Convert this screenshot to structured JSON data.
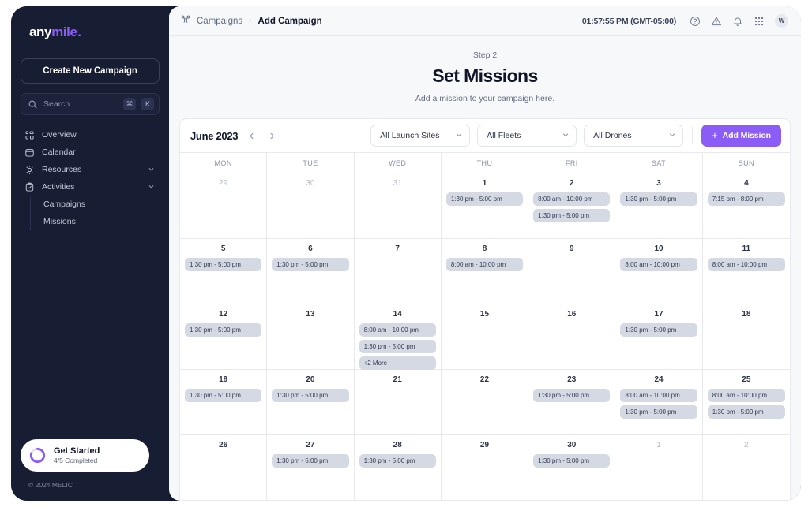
{
  "sidebar": {
    "logo": {
      "part1": "any",
      "part2": "mile",
      "dot": "."
    },
    "create_button": "Create New Campaign",
    "search": {
      "placeholder": "Search",
      "kbd1": "⌘",
      "kbd2": "K",
      "icon": "search-icon"
    },
    "items": [
      {
        "label": "Overview",
        "icon": "overview-grid-icon",
        "expandable": false
      },
      {
        "label": "Calendar",
        "icon": "calendar-icon",
        "expandable": false
      },
      {
        "label": "Resources",
        "icon": "sun-resources-icon",
        "expandable": true
      },
      {
        "label": "Activities",
        "icon": "clipboard-check-icon",
        "expandable": true
      }
    ],
    "sub_items": [
      {
        "label": "Campaigns"
      },
      {
        "label": "Missions"
      }
    ],
    "get_started": {
      "title": "Get Started",
      "subtitle": "4/5 Completed",
      "progress": 80
    },
    "copyright": "© 2024 MELIC"
  },
  "topbar": {
    "breadcrumb": {
      "icon": "drone-icon",
      "parent": "Campaigns",
      "separator": "›",
      "current": "Add Campaign"
    },
    "clock": "01:57:55 PM (GMT-05:00)",
    "icons": [
      "help-circle-icon",
      "warning-triangle-icon",
      "bell-icon",
      "apps-grid-icon"
    ],
    "avatar_initial": "W"
  },
  "step": {
    "kicker": "Step 2",
    "title": "Set Missions",
    "subtitle": "Add a mission to your campaign here."
  },
  "calendar": {
    "month_label": "June 2023",
    "prev_label": "‹",
    "next_label": "›",
    "filters": [
      {
        "name": "launch-sites",
        "value": "All Launch Sites"
      },
      {
        "name": "fleets",
        "value": "All Fleets"
      },
      {
        "name": "drones",
        "value": "All Drones"
      }
    ],
    "add_mission_label": "Add Mission",
    "accent_color": "#8b5cf6",
    "pill_color": "#d5d9e3",
    "day_headers": [
      "MON",
      "TUE",
      "WED",
      "THU",
      "FRI",
      "SAT",
      "SUN"
    ],
    "weeks": [
      [
        {
          "day": "29",
          "muted": true,
          "events": []
        },
        {
          "day": "30",
          "muted": true,
          "events": []
        },
        {
          "day": "31",
          "muted": true,
          "events": []
        },
        {
          "day": "1",
          "muted": false,
          "events": [
            "1:30 pm - 5:00 pm"
          ]
        },
        {
          "day": "2",
          "muted": false,
          "events": [
            "8:00 am - 10:00 pm",
            "1:30 pm - 5:00 pm"
          ]
        },
        {
          "day": "3",
          "muted": false,
          "events": [
            "1:30 pm - 5:00 pm"
          ]
        },
        {
          "day": "4",
          "muted": false,
          "events": [
            "7:15 pm - 8:00 pm"
          ]
        }
      ],
      [
        {
          "day": "5",
          "muted": false,
          "events": [
            "1:30 pm - 5:00 pm"
          ]
        },
        {
          "day": "6",
          "muted": false,
          "events": [
            "1:30 pm - 5:00 pm"
          ]
        },
        {
          "day": "7",
          "muted": false,
          "events": []
        },
        {
          "day": "8",
          "muted": false,
          "events": [
            "8:00 am - 10:00 pm"
          ]
        },
        {
          "day": "9",
          "muted": false,
          "events": []
        },
        {
          "day": "10",
          "muted": false,
          "events": [
            "8:00 am - 10:00 pm"
          ]
        },
        {
          "day": "11",
          "muted": false,
          "events": [
            "8:00 am - 10:00 pm"
          ]
        }
      ],
      [
        {
          "day": "12",
          "muted": false,
          "events": [
            "1:30 pm - 5:00 pm"
          ]
        },
        {
          "day": "13",
          "muted": false,
          "events": []
        },
        {
          "day": "14",
          "muted": false,
          "events": [
            "8:00 am - 10:00 pm",
            "1:30 pm - 5:00 pm",
            "+2 More"
          ]
        },
        {
          "day": "15",
          "muted": false,
          "events": []
        },
        {
          "day": "16",
          "muted": false,
          "events": []
        },
        {
          "day": "17",
          "muted": false,
          "events": [
            "1:30 pm - 5:00 pm"
          ]
        },
        {
          "day": "18",
          "muted": false,
          "events": []
        }
      ],
      [
        {
          "day": "19",
          "muted": false,
          "events": [
            "1:30 pm - 5:00 pm"
          ]
        },
        {
          "day": "20",
          "muted": false,
          "events": [
            "1:30 pm - 5:00 pm"
          ]
        },
        {
          "day": "21",
          "muted": false,
          "events": []
        },
        {
          "day": "22",
          "muted": false,
          "events": []
        },
        {
          "day": "23",
          "muted": false,
          "events": [
            "1:30 pm - 5:00 pm"
          ]
        },
        {
          "day": "24",
          "muted": false,
          "events": [
            "8:00 am - 10:00 pm",
            "1:30 pm - 5:00 pm"
          ]
        },
        {
          "day": "25",
          "muted": false,
          "events": [
            "8:00 am - 10:00 pm",
            "1:30 pm - 5:00 pm"
          ]
        }
      ],
      [
        {
          "day": "26",
          "muted": false,
          "events": []
        },
        {
          "day": "27",
          "muted": false,
          "events": [
            "1:30 pm - 5:00 pm"
          ]
        },
        {
          "day": "28",
          "muted": false,
          "events": [
            "1:30 pm - 5:00 pm"
          ]
        },
        {
          "day": "29",
          "muted": false,
          "events": []
        },
        {
          "day": "30",
          "muted": false,
          "events": [
            "1:30 pm - 5:00 pm"
          ]
        },
        {
          "day": "1",
          "muted": true,
          "events": []
        },
        {
          "day": "2",
          "muted": true,
          "events": []
        }
      ]
    ]
  }
}
